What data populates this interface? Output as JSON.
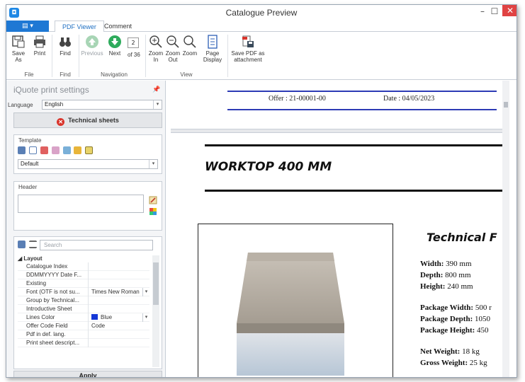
{
  "window": {
    "title": "Catalogue Preview",
    "app_icon": "app-logo-icon",
    "minimize": "–",
    "maximize": "☐",
    "close": "✕"
  },
  "ribbon_tabs": [
    {
      "label": "PDF Viewer",
      "active": true
    },
    {
      "label": "Comment",
      "active": false
    }
  ],
  "ribbon": {
    "file_group": {
      "buttons": [
        {
          "label": "Save As",
          "icon": "save-as-icon"
        },
        {
          "label": "Print",
          "icon": "print-icon"
        }
      ],
      "group_label": "File"
    },
    "find_group": {
      "buttons": [
        {
          "label": "Find",
          "icon": "binoculars-icon"
        }
      ],
      "group_label": "Find"
    },
    "navigation_group": {
      "previous": {
        "label": "Previous",
        "icon": "arrow-up-icon",
        "enabled": false
      },
      "next": {
        "label": "Next",
        "icon": "arrow-down-icon",
        "enabled": true
      },
      "current_page": "2",
      "of_pages": "of 36",
      "group_label": "Navigation"
    },
    "view_group": {
      "buttons": [
        {
          "label": "Zoom In",
          "icon": "zoom-in-icon"
        },
        {
          "label": "Zoom Out",
          "icon": "zoom-out-icon"
        },
        {
          "label": "Zoom",
          "icon": "zoom-icon"
        },
        {
          "label": "Page Display",
          "icon": "page-display-icon"
        }
      ],
      "group_label": "View"
    },
    "attachment": {
      "label": "Save PDF as attachment",
      "icon": "pdf-attachment-icon"
    }
  },
  "left_panel": {
    "title": "iQuote print settings",
    "pin_icon": "pin-icon",
    "language_label": "Language",
    "language_value": "English",
    "technical_sheets_button": "Technical sheets",
    "template": {
      "title": "Template",
      "tools": [
        "save-icon",
        "new-icon",
        "delete-icon",
        "edit-icon",
        "copy-icon",
        "import-icon",
        "preview-icon"
      ],
      "selected": "Default"
    },
    "header": {
      "title": "Header",
      "value": ""
    },
    "properties": {
      "search_placeholder": "Search",
      "group": "Layout",
      "rows": [
        {
          "name": "Catalogue Index",
          "value": "",
          "checked": true
        },
        {
          "name": "DDMMYYYY Date F...",
          "value": "",
          "checked": true
        },
        {
          "name": "Existing",
          "value": "",
          "checked": true
        },
        {
          "name": "Font (OTF is not su...",
          "value": "Times New Roman",
          "checked": null
        },
        {
          "name": "Group by Technical...",
          "value": "",
          "checked": true
        },
        {
          "name": "Introductive Sheet",
          "value": "",
          "checked": true
        },
        {
          "name": "Lines Color",
          "value": "Blue",
          "checked": null
        },
        {
          "name": "Offer Code Field",
          "value": "Code",
          "checked": null
        },
        {
          "name": "Pdf in def. lang.",
          "value": "",
          "checked": true
        },
        {
          "name": "Print sheet descript...",
          "value": "",
          "checked": false
        }
      ]
    },
    "apply_button": "Apply"
  },
  "document": {
    "offer": "Offer : 21-00001-00",
    "date": "Date : 04/05/2023",
    "product_title": "WORKTOP 400 MM",
    "tech_heading": "Technical F",
    "specs": [
      {
        "label": "Width:",
        "value": "390 mm"
      },
      {
        "label": "Depth:",
        "value": "800 mm"
      },
      {
        "label": "Height:",
        "value": "240 mm"
      },
      {
        "label": "Package Width:",
        "value": "500 r"
      },
      {
        "label": "Package Depth:",
        "value": "1050"
      },
      {
        "label": "Package Height:",
        "value": "450"
      },
      {
        "label": "Net Weight:",
        "value": "18 kg"
      },
      {
        "label": "Gross Weight:",
        "value": "25 kg"
      }
    ]
  },
  "colors": {
    "accent": "#1e78d4",
    "close_button": "#e04343",
    "offer_lines": "#2d3bb5",
    "lines_color_swatch": "#1437d6"
  }
}
